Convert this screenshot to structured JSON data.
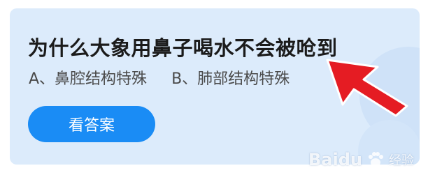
{
  "question": {
    "text": "为什么大象用鼻子喝水不会被呛到"
  },
  "options": [
    {
      "label": "A、鼻腔结构特殊"
    },
    {
      "label": "B、肺部结构特殊"
    }
  ],
  "answer_button": {
    "label": "看答案"
  },
  "watermark": {
    "brand": "Baidu",
    "sub": "经验"
  },
  "colors": {
    "card_bg": "#dcebfb",
    "button": "#1a8cf5",
    "arrow": "#e51c23"
  },
  "icons": {
    "arrow": "arrow-pointer-icon",
    "watermark": "baidu-paw-icon"
  }
}
